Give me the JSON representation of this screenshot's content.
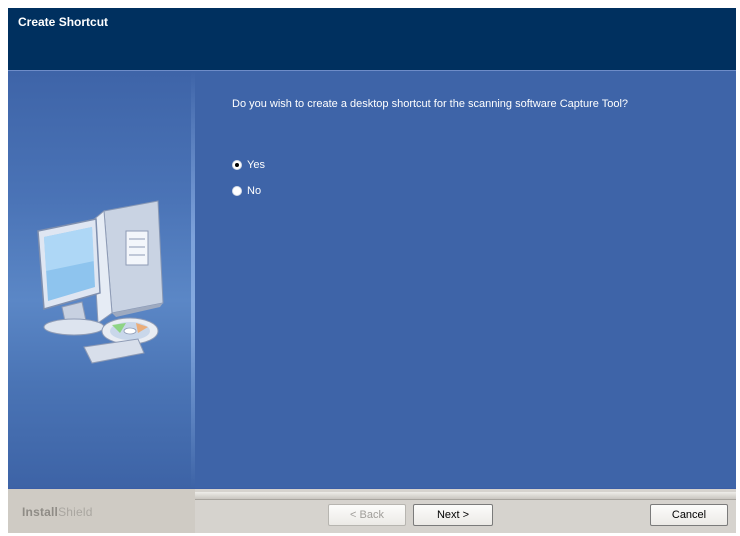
{
  "window": {
    "title": "Create Shortcut"
  },
  "main": {
    "question": "Do you wish to create a desktop shortcut for the scanning software Capture Tool?",
    "options": [
      {
        "label": "Yes",
        "selected": true
      },
      {
        "label": "No",
        "selected": false
      }
    ]
  },
  "footer": {
    "brand_bold": "Install",
    "brand_light": "Shield",
    "back_label": "< Back",
    "next_label": "Next >",
    "cancel_label": "Cancel"
  },
  "colors": {
    "title_bar": "#00305f",
    "content_bg": "#3e64a8",
    "bottom_bar": "#d6d3ce"
  },
  "icons": {
    "illustration": "computer-cd-icon"
  }
}
